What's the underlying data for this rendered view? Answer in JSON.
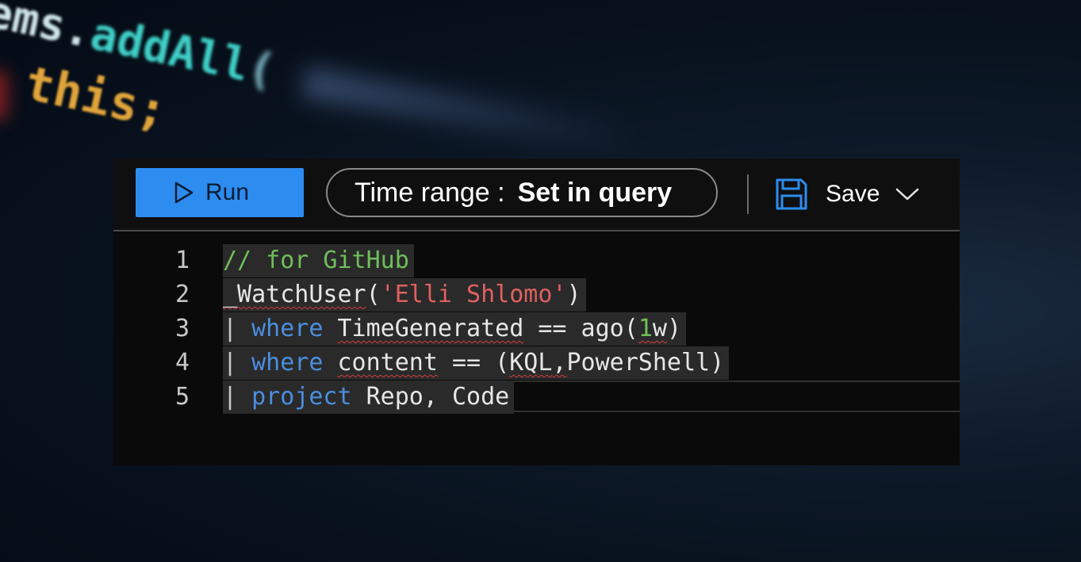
{
  "toolbar": {
    "run_label": "Run",
    "time_range_label": "Time range :",
    "time_range_value": "Set in query",
    "save_label": "Save"
  },
  "editor": {
    "line_numbers": [
      "1",
      "2",
      "3",
      "4",
      "5"
    ],
    "lines": {
      "l1": {
        "comment": "// for GitHub"
      },
      "l2": {
        "func": "_WatchUser",
        "open": "(",
        "arg": "'Elli Shlomo'",
        "close": ")"
      },
      "l3": {
        "pipe": "|",
        "kw": "where",
        "field": "TimeGenerated",
        "op": " == ago(",
        "num": "1",
        "unit": "w",
        "close": ")"
      },
      "l4": {
        "pipe": "|",
        "kw": "where",
        "field": "content",
        "op": " == (",
        "v1": "KQL",
        "comma": ",",
        "v2": "PowerShell",
        "close": ")"
      },
      "l5": {
        "pipe": "|",
        "kw": "project",
        "rest": " Repo, Code"
      }
    }
  },
  "background": {
    "line1_obj": "ems",
    "line1_dot": ".",
    "line1_fn": "addAll",
    "line1_paren": "(",
    "line2": "this;"
  },
  "colors": {
    "run_button": "#2d8cf0",
    "comment": "#6fbf5a",
    "string": "#e06060",
    "keyword": "#4a8fe0",
    "squiggle": "#d83b3b"
  },
  "icons": {
    "run": "play-icon",
    "save": "floppy-disk-icon",
    "dropdown": "chevron-down-icon"
  }
}
